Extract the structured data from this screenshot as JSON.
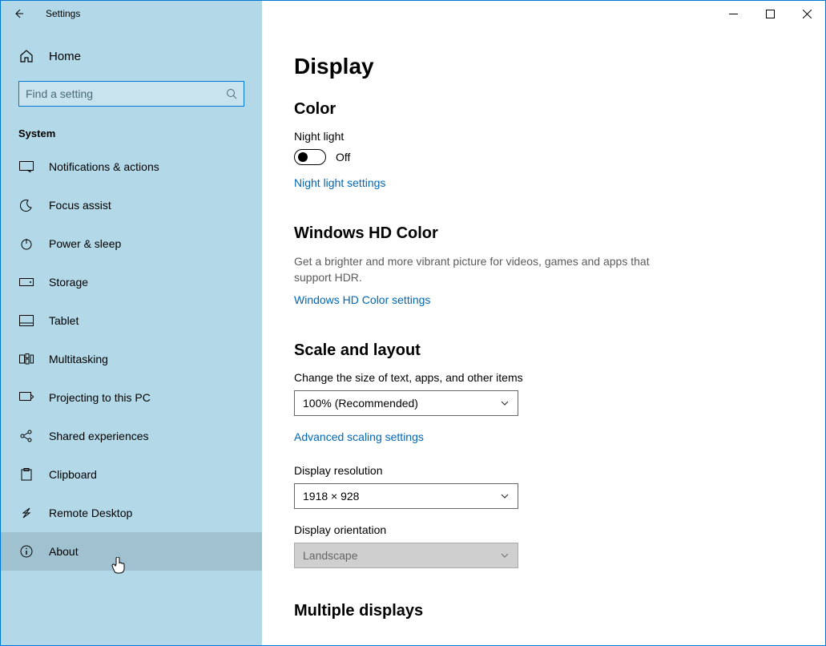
{
  "window": {
    "title": "Settings"
  },
  "sidebar": {
    "home": "Home",
    "search_placeholder": "Find a setting",
    "category": "System",
    "items": [
      {
        "label": "Notifications & actions",
        "icon": "notifications-icon"
      },
      {
        "label": "Focus assist",
        "icon": "moon-icon"
      },
      {
        "label": "Power & sleep",
        "icon": "power-icon"
      },
      {
        "label": "Storage",
        "icon": "storage-icon"
      },
      {
        "label": "Tablet",
        "icon": "tablet-icon"
      },
      {
        "label": "Multitasking",
        "icon": "multitasking-icon"
      },
      {
        "label": "Projecting to this PC",
        "icon": "project-icon"
      },
      {
        "label": "Shared experiences",
        "icon": "shared-icon"
      },
      {
        "label": "Clipboard",
        "icon": "clipboard-icon"
      },
      {
        "label": "Remote Desktop",
        "icon": "remote-icon"
      },
      {
        "label": "About",
        "icon": "info-icon",
        "hover": true
      }
    ]
  },
  "main": {
    "title": "Display",
    "color": {
      "heading": "Color",
      "night_label": "Night light",
      "toggle_state": "Off",
      "link": "Night light settings"
    },
    "hd": {
      "heading": "Windows HD Color",
      "desc": "Get a brighter and more vibrant picture for videos, games and apps that support HDR.",
      "link": "Windows HD Color settings"
    },
    "scale": {
      "heading": "Scale and layout",
      "scale_label": "Change the size of text, apps, and other items",
      "scale_value": "100% (Recommended)",
      "adv_link": "Advanced scaling settings",
      "res_label": "Display resolution",
      "res_value": "1918 × 928",
      "orient_label": "Display orientation",
      "orient_value": "Landscape"
    },
    "multi": {
      "heading": "Multiple displays"
    }
  }
}
